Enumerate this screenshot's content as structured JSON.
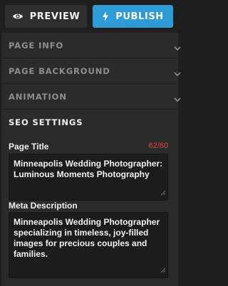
{
  "toolbar": {
    "preview_label": "PREVIEW",
    "publish_label": "PUBLISH",
    "preview_icon": "eye-icon",
    "publish_icon": "lightning-icon",
    "publish_color": "#2d9bd6"
  },
  "sections": [
    {
      "label": "PAGE INFO",
      "expanded": false
    },
    {
      "label": "PAGE BACKGROUND",
      "expanded": false
    },
    {
      "label": "ANIMATION",
      "expanded": false
    },
    {
      "label": "SEO SETTINGS",
      "expanded": true
    }
  ],
  "seo": {
    "page_title": {
      "label": "Page Title",
      "counter": "62/60",
      "counter_color": "#e0453a",
      "value": "Minneapolis Wedding Photographer: Luminous Moments Photography"
    },
    "meta_description": {
      "label": "Meta Description",
      "value": "Minneapolis Wedding Photographer specializing in timeless, joy-filled images for precious couples and families."
    }
  }
}
